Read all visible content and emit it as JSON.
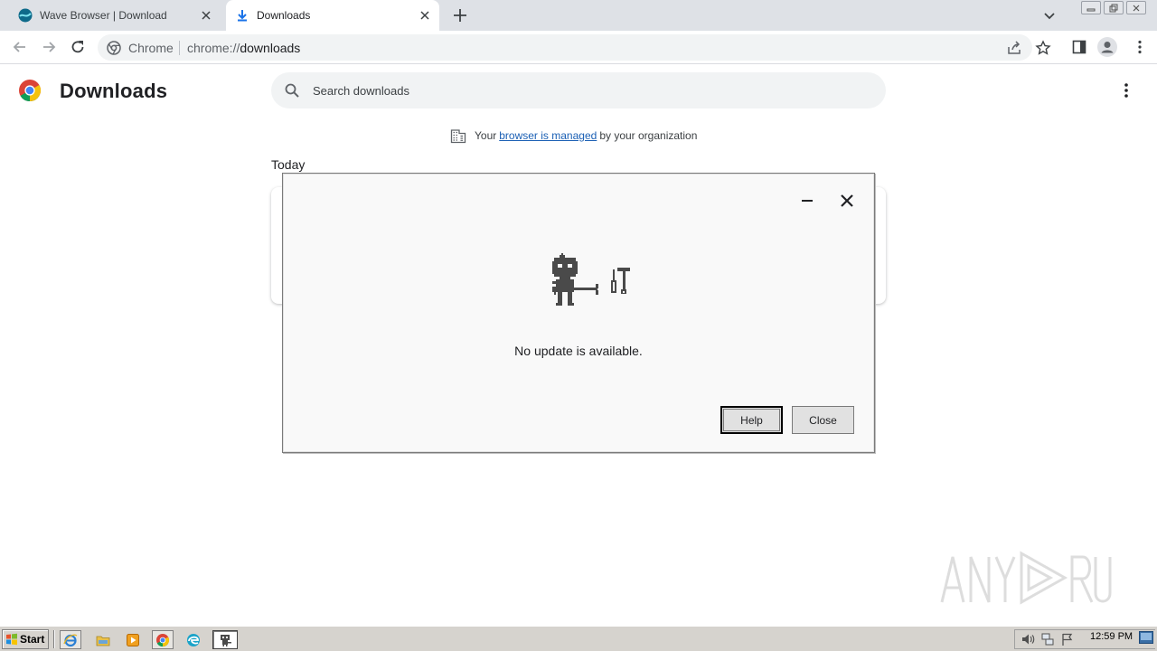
{
  "tabs": [
    {
      "title": "Wave Browser | Download",
      "icon": "wave-browser-icon",
      "active": false
    },
    {
      "title": "Downloads",
      "icon": "download-icon",
      "active": true
    }
  ],
  "toolbar": {
    "chip": "Chrome",
    "url_scheme": "chrome://",
    "url_host": "downloads"
  },
  "page": {
    "title": "Downloads",
    "search_placeholder": "Search downloads",
    "managed_prefix": "Your",
    "managed_link": "browser is managed",
    "managed_suffix": "by your organization",
    "section_today": "Today"
  },
  "dialog": {
    "message": "No update is available.",
    "help_label": "Help",
    "close_label": "Close"
  },
  "taskbar": {
    "start_label": "Start",
    "clock": "12:59 PM"
  },
  "colors": {
    "tabstrip": "#dee1e6",
    "link": "#1a5fb4",
    "robot": "#4a4a4a",
    "taskbar": "#d6d3ce"
  }
}
